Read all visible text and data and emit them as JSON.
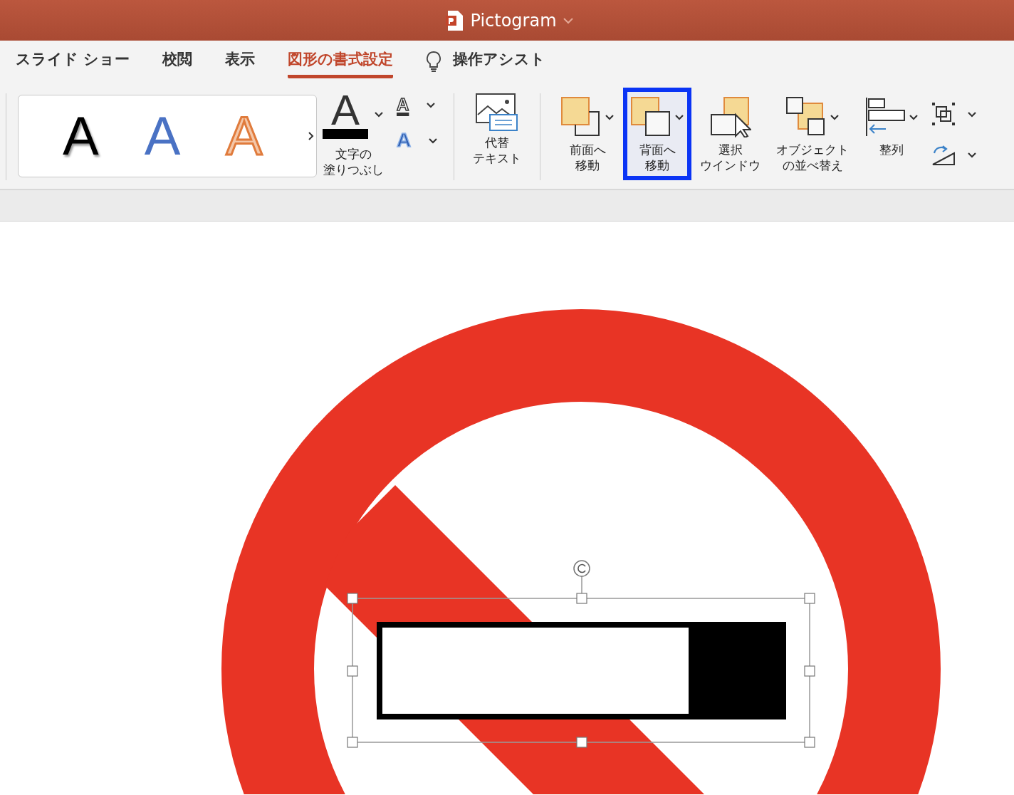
{
  "window": {
    "title": "Pictogram"
  },
  "tabs": [
    {
      "label": "スライド ショー",
      "selected": false
    },
    {
      "label": "校閲",
      "selected": false
    },
    {
      "label": "表示",
      "selected": false
    },
    {
      "label": "図形の書式設定",
      "selected": true
    }
  ],
  "tell_me": {
    "label": "操作アシスト"
  },
  "wordart_styles": [
    {
      "letter": "A",
      "kind": "shadow"
    },
    {
      "letter": "A",
      "kind": "blue"
    },
    {
      "letter": "A",
      "kind": "outline"
    }
  ],
  "text_fill": {
    "glyph": "A",
    "label_lines": [
      "文字の",
      "塗りつぶし"
    ]
  },
  "text_outline": {
    "glyph": "A"
  },
  "text_effects": {
    "glyph": "A"
  },
  "alt_text": {
    "label_lines": [
      "代替",
      "テキスト"
    ]
  },
  "arrange_buttons": [
    {
      "kind": "forward",
      "label_lines": [
        "前面へ",
        "移動"
      ],
      "dropdown": true,
      "highlighted": false
    },
    {
      "kind": "backward",
      "label_lines": [
        "背面へ",
        "移動"
      ],
      "dropdown": true,
      "highlighted": true
    },
    {
      "kind": "pane",
      "label_lines": [
        "選択",
        "ウインドウ"
      ],
      "dropdown": false,
      "highlighted": false
    },
    {
      "kind": "reorder",
      "label_lines": [
        "オブジェクト",
        "の並べ替え"
      ],
      "dropdown": true,
      "highlighted": false
    },
    {
      "kind": "align",
      "label_lines": [
        "整列"
      ],
      "dropdown": true,
      "highlighted": false
    }
  ],
  "slide": {
    "shape_selected": true
  }
}
